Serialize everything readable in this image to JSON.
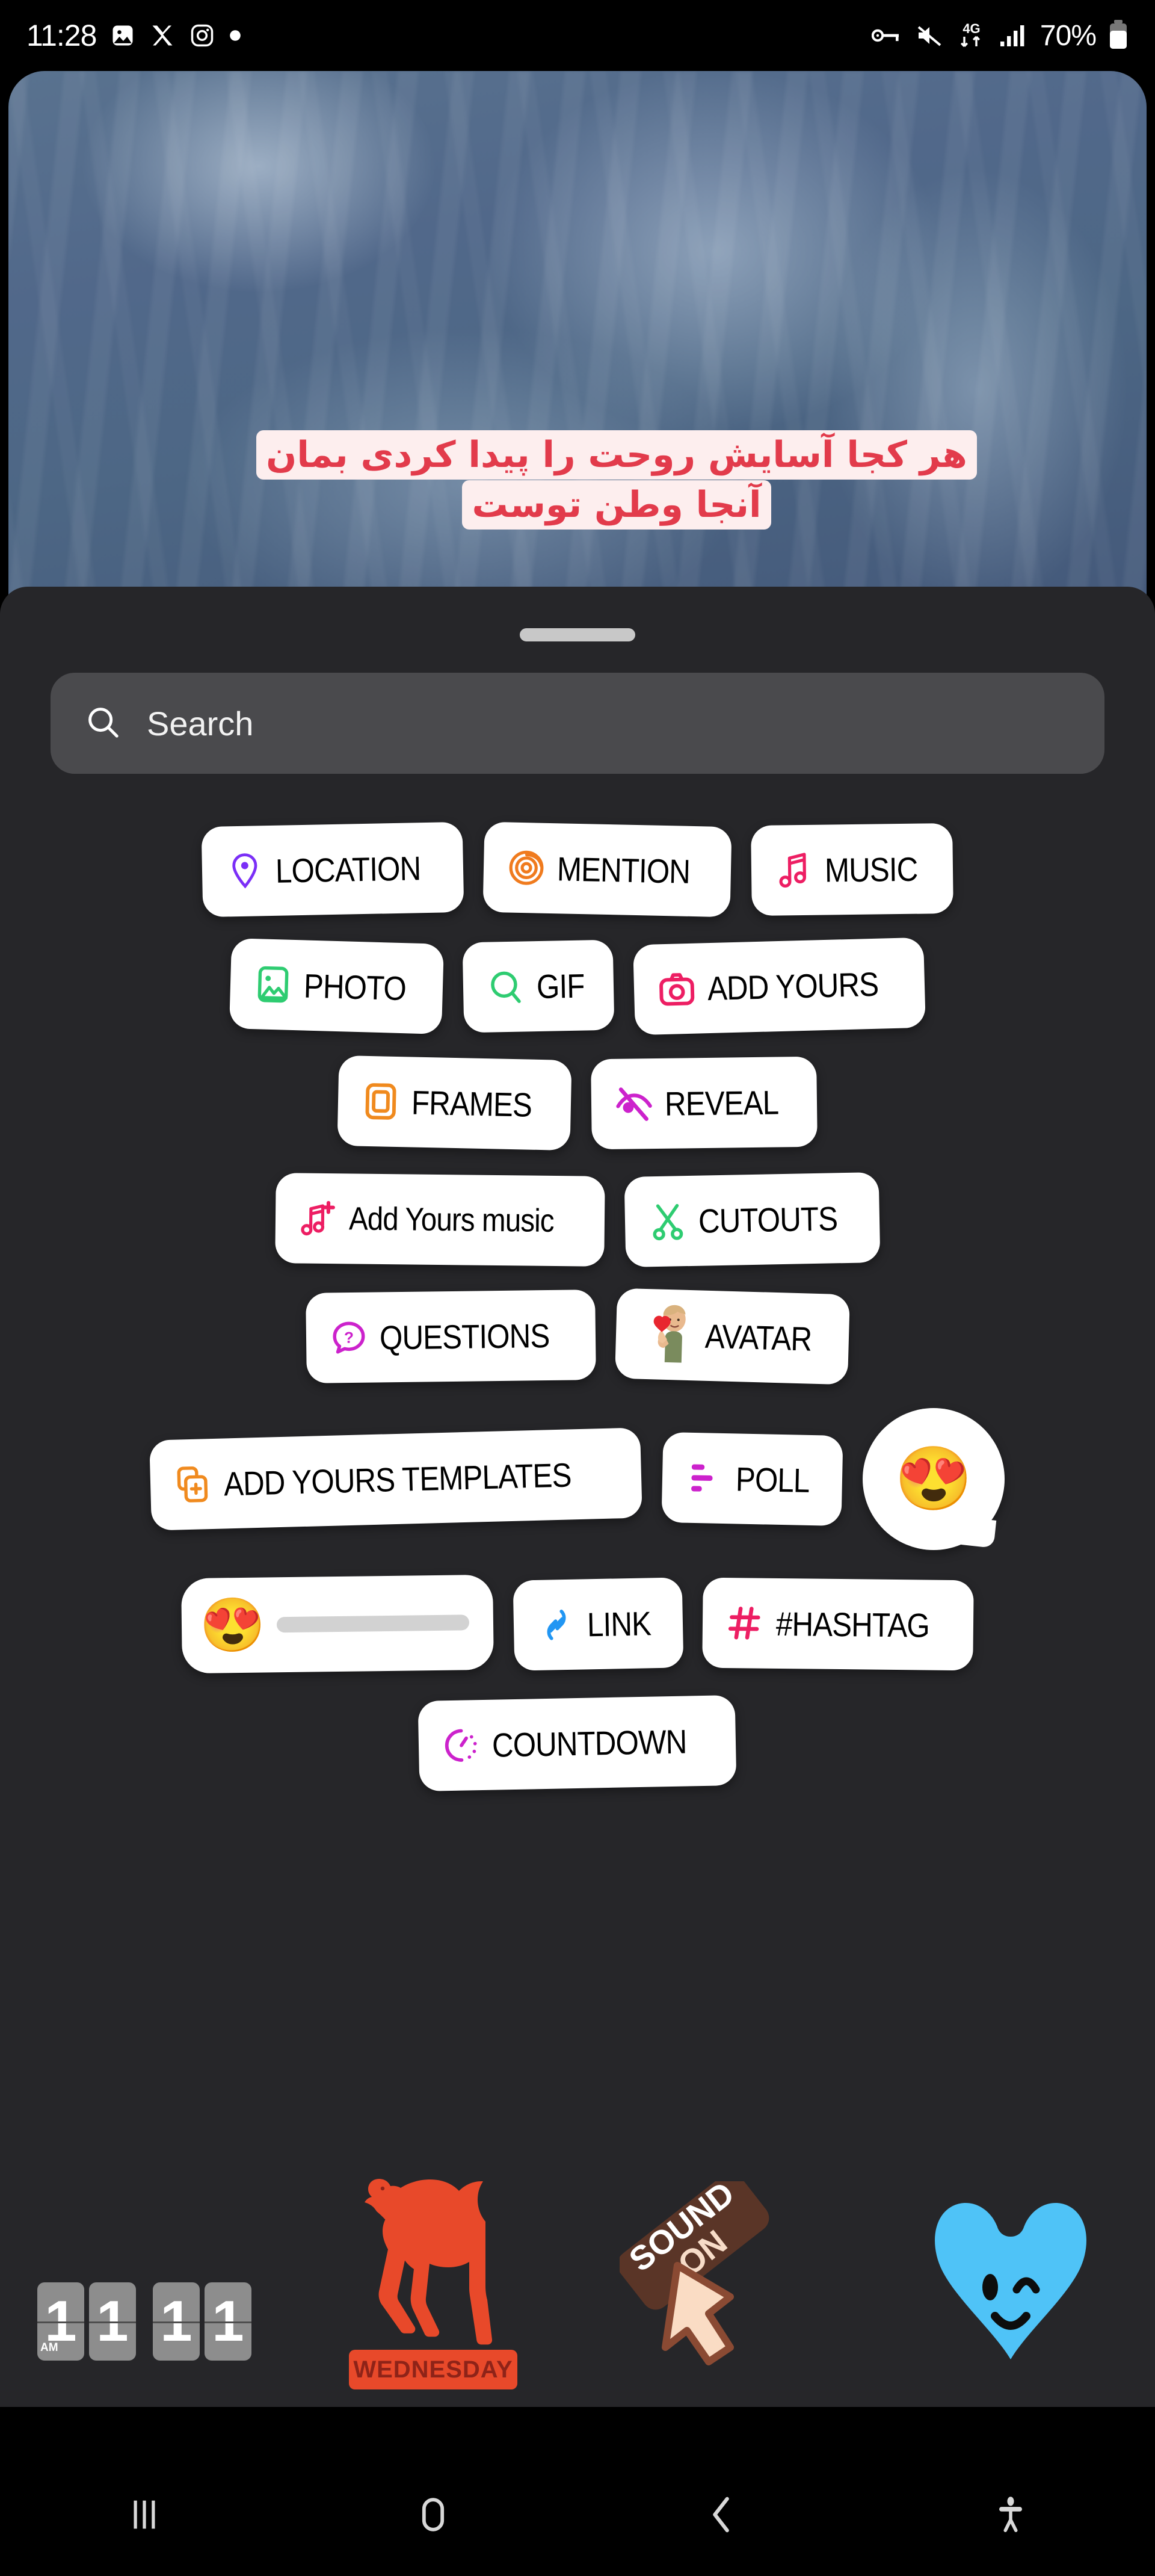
{
  "status_bar": {
    "time": "11:28",
    "battery_percent": "70%",
    "network": "4G",
    "left_icons": [
      "photo-icon",
      "x-app-icon",
      "instagram-icon",
      "dot-icon"
    ],
    "right_icons": [
      "vpn-key-icon",
      "mute-icon",
      "4g-data-icon",
      "signal-bars-icon",
      "battery-icon"
    ]
  },
  "story": {
    "text_line1": "هر کجا آسایش روحت را پیدا کردی بمان",
    "text_line2": "آنجا وطن توست",
    "text_color": "#e23b4b",
    "text_bg": "#fdeeee"
  },
  "search": {
    "placeholder": "Search",
    "icon": "search-icon"
  },
  "sheet": {
    "background": "#262629",
    "handle": "drag-handle"
  },
  "sticker_rows": [
    {
      "chips": [
        {
          "label": "LOCATION",
          "icon": "location-pin-icon",
          "color": "#7B2FF7"
        },
        {
          "label": "MENTION",
          "icon": "threads-at-icon",
          "color": "#F07B1E"
        },
        {
          "label": "MUSIC",
          "icon": "music-note-icon",
          "color": "#ED1E63"
        }
      ]
    },
    {
      "chips": [
        {
          "label": "PHOTO",
          "icon": "photo-icon",
          "color": "#2ECC71"
        },
        {
          "label": "GIF",
          "icon": "gif-search-icon",
          "color": "#2ECC71"
        },
        {
          "label": "ADD YOURS",
          "icon": "camera-icon",
          "color": "#ED1E63"
        }
      ]
    },
    {
      "chips": [
        {
          "label": "FRAMES",
          "icon": "frame-icon",
          "color": "#F08A1E"
        },
        {
          "label": "REVEAL",
          "icon": "eye-slash-icon",
          "color": "#CC22CC"
        }
      ]
    },
    {
      "chips": [
        {
          "label": "Add Yours music",
          "icon": "music-note-plus-icon",
          "color": "#ED1E63"
        },
        {
          "label": "CUTOUTS",
          "icon": "scissors-icon",
          "color": "#2ECC71"
        }
      ]
    },
    {
      "chips": [
        {
          "label": "QUESTIONS",
          "icon": "question-bubble-icon",
          "color": "#CC22CC"
        },
        {
          "label": "AVATAR",
          "icon": "avatar-heart-hands-icon",
          "color": "#C08B6A"
        }
      ]
    },
    {
      "chips": [
        {
          "label": "ADD YOURS TEMPLATES",
          "icon": "templates-plus-icon",
          "color": "#F08A1E"
        },
        {
          "label": "POLL",
          "icon": "poll-bars-icon",
          "color": "#CC22CC"
        },
        {
          "label": "",
          "icon": "heart-eyes-emoji-bubble",
          "emoji": "😍"
        }
      ]
    },
    {
      "chips": [
        {
          "label": "",
          "icon": "emoji-slider",
          "emoji": "😍"
        },
        {
          "label": "LINK",
          "icon": "link-chain-icon",
          "color": "#2196F3"
        },
        {
          "label": "#HASHTAG",
          "icon": "hashtag-icon",
          "color": "#ED1E63"
        }
      ]
    },
    {
      "chips": [
        {
          "label": "COUNTDOWN",
          "icon": "countdown-timer-icon",
          "color": "#CC22CC"
        }
      ]
    }
  ],
  "bottom_stickers": [
    {
      "name": "flip-clock-sticker",
      "digits": [
        "1",
        "1",
        "1",
        "1"
      ],
      "meridiem": "AM"
    },
    {
      "name": "camel-wednesday-sticker",
      "label": "WEDNESDAY",
      "color": "#e8492a"
    },
    {
      "name": "sound-on-sticker",
      "label": "SOUND ON"
    },
    {
      "name": "blue-winking-heart-sticker",
      "color": "#4FC3F7"
    }
  ],
  "nav_bar": {
    "buttons": [
      {
        "name": "recents-button",
        "icon": "recents-icon"
      },
      {
        "name": "home-button",
        "icon": "home-icon"
      },
      {
        "name": "back-button",
        "icon": "back-chevron-icon"
      },
      {
        "name": "accessibility-button",
        "icon": "accessibility-icon"
      }
    ]
  }
}
